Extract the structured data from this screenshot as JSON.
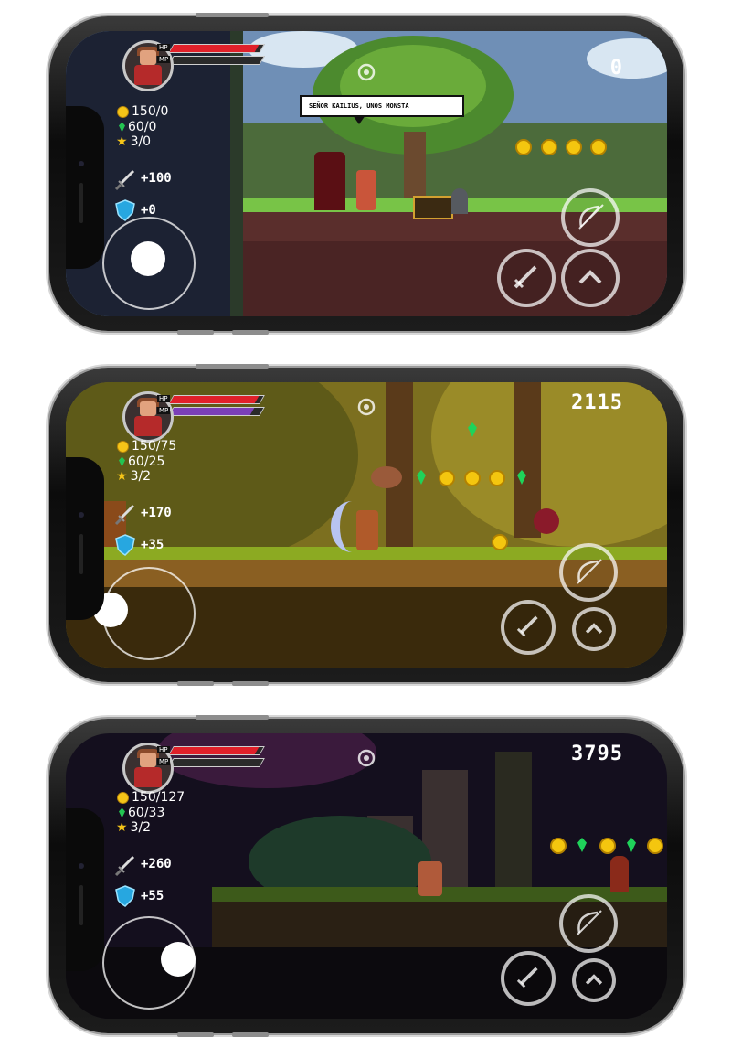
{
  "screens": [
    {
      "hud": {
        "hp_label": "HP",
        "mp_label": "MP",
        "hp_fill": 0.95,
        "mp_fill": 0.0,
        "coins": "150/0",
        "gems": "60/0",
        "stars": "3/0",
        "attack": "+100",
        "defense": "+0",
        "score": "0"
      },
      "dialog": "SEÑOR KAILIUS, UNOS MONSTA"
    },
    {
      "hud": {
        "hp_label": "HP",
        "mp_label": "MP",
        "hp_fill": 0.95,
        "mp_fill": 0.9,
        "coins": "150/75",
        "gems": "60/25",
        "stars": "3/2",
        "attack": "+170",
        "defense": "+35",
        "score": "2115"
      }
    },
    {
      "hud": {
        "hp_label": "HP",
        "mp_label": "MP",
        "hp_fill": 0.95,
        "mp_fill": 0.0,
        "coins": "150/127",
        "gems": "60/33",
        "stars": "3/2",
        "attack": "+260",
        "defense": "+55",
        "score": "3795"
      }
    }
  ],
  "icons": [
    "settings-icon",
    "sword-icon",
    "shield-icon",
    "bow-icon",
    "jump-arrow-icon",
    "coin-icon",
    "gem-icon",
    "star-icon"
  ],
  "colors": {
    "hp": "#e0202a",
    "mp": "#7b3fb8",
    "coin": "#f4c60f",
    "gem": "#1fd35a"
  }
}
